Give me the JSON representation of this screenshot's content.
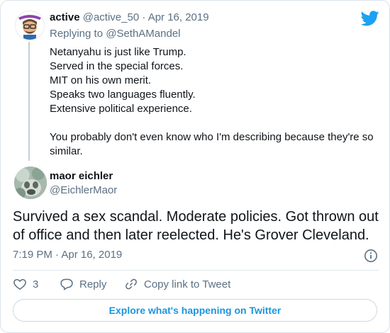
{
  "colors": {
    "twitter_blue": "#1da1f2",
    "link_blue": "#1b95e0",
    "muted": "#5b7083",
    "text": "#0f1419"
  },
  "reply_tweet": {
    "avatar_icon": "bitmoji-avatar-icon",
    "name": "active",
    "handle": "@active_50",
    "separator": "·",
    "date": "Apr 16, 2019",
    "replying_prefix": "Replying to",
    "replying_to": "@SethAMandel",
    "lines": [
      "Netanyahu is just like Trump.",
      "Served in the special forces.",
      "MIT on his own merit.",
      "Speaks two languages fluently.",
      "Extensive political experience."
    ],
    "closing": "You probably don't even know who I'm describing because they're so similar."
  },
  "main_tweet": {
    "avatar_icon": "profile-photo-icon",
    "name": "maor eichler",
    "handle": "@EichlerMaor",
    "text": "Survived a sex scandal. Moderate policies. Got thrown out of office and then later reelected. He's Grover Cleveland.",
    "timestamp": "7:19 PM · Apr 16, 2019"
  },
  "actions": {
    "like_count": "3",
    "reply_label": "Reply",
    "copy_link_label": "Copy link to Tweet"
  },
  "explore_label": "Explore what's happening on Twitter"
}
